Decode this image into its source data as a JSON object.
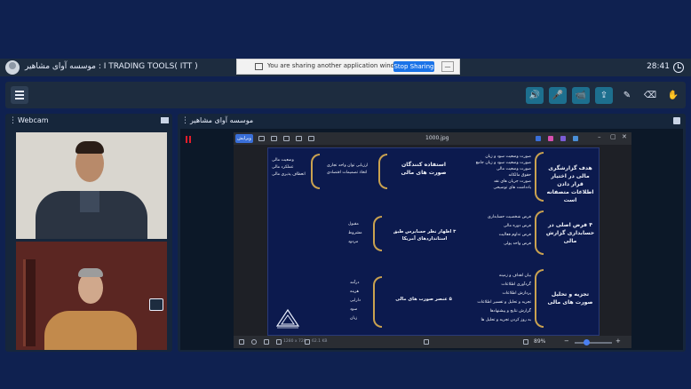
{
  "titlebar": {
    "title": "موسسه آوای مشاهیر : I TRADING TOOLS( ITT )",
    "time": "28:41",
    "avatar_icon": "user-avatar-icon",
    "clock_icon": "clock-icon"
  },
  "share_notice": {
    "text": "You are sharing another application window.",
    "stop_label": "Stop Sharing",
    "minimize_label": "—"
  },
  "toolbar": {
    "menu_icon": "hamburger-menu-icon",
    "buttons": [
      {
        "name": "speaker-icon",
        "glyph": "🔊"
      },
      {
        "name": "microphone-icon",
        "glyph": "🎤"
      },
      {
        "name": "camera-icon",
        "glyph": "📹"
      },
      {
        "name": "screen-share-icon",
        "glyph": "⇪"
      },
      {
        "name": "pen-icon",
        "glyph": "✎"
      },
      {
        "name": "eraser-icon",
        "glyph": "⌫"
      },
      {
        "name": "raise-hand-icon",
        "glyph": "✋"
      }
    ],
    "accent": "#1d6f8e"
  },
  "webcam": {
    "title": "Webcam",
    "menu_glyph": "⋮"
  },
  "share_panel": {
    "title": "موسسه آوای مشاهیر",
    "menu_glyph": "⋮"
  },
  "viewer": {
    "edit_label": "ویرایش",
    "filename": "1000.jpg",
    "window_controls": [
      "–",
      "▢",
      "✕"
    ],
    "dimensions": "1280 x 720",
    "file_size": "62.1 KB",
    "zoom": "89%",
    "zoom_in": "+",
    "zoom_out": "−"
  },
  "slide": {
    "right_heading_1": "هدف گزارشگری مالی در اختیار قرار دادن اطلاعات متصفانه است",
    "right_items_1": [
      "صورت وضعیت سود و زیان",
      "صورت وضعیت سود و زیان جامع",
      "صورت وضعیت مالی",
      "حقوق مالکانه",
      "صورت جریان های نقد",
      "یادداشت های توضیحی"
    ],
    "mid_heading_1": "استفاده کنندگان صورت های مالی",
    "mid_items_1": [
      "ارزیابی توان واحد تجاری",
      "اتخاذ تصمیمات اقتصادی"
    ],
    "left_items_1": [
      "وضعیت مالی",
      "عملکرد مالی",
      "انعطاف پذیری مالی"
    ],
    "right_heading_2": "۴ فرض اصلی در حسابداری گزارش مالی",
    "right_items_2": [
      "فرض شخصیت حسابداری",
      "فرض دوره مالی",
      "فرض تداوم فعالیت",
      "فرض واحد پولی"
    ],
    "mid_heading_2": "۳ اظهار نظر حسابرس طبق استانداردهای آمریکا",
    "left_items_2": [
      "مقبول",
      "مشروط",
      "مردود"
    ],
    "right_heading_3": "تجزیه و تحلیل صورت های مالی",
    "right_items_3": [
      "بیان اهداف و زمینه",
      "گردآوری اطلاعات",
      "پردازش اطلاعات",
      "تجزیه و تحلیل و تفسیر اطلاعات",
      "گزارش نتایج و پیشنهادها",
      "به روز کردن تجزیه و تحلیل ها"
    ],
    "mid_heading_3": "۵ عنصر صورت های مالی",
    "left_items_3": [
      "درآمد",
      "هزینه",
      "دارایی",
      "سود",
      "زیان"
    ],
    "brace_color": "#caa250",
    "background": "#0c1a4e"
  }
}
